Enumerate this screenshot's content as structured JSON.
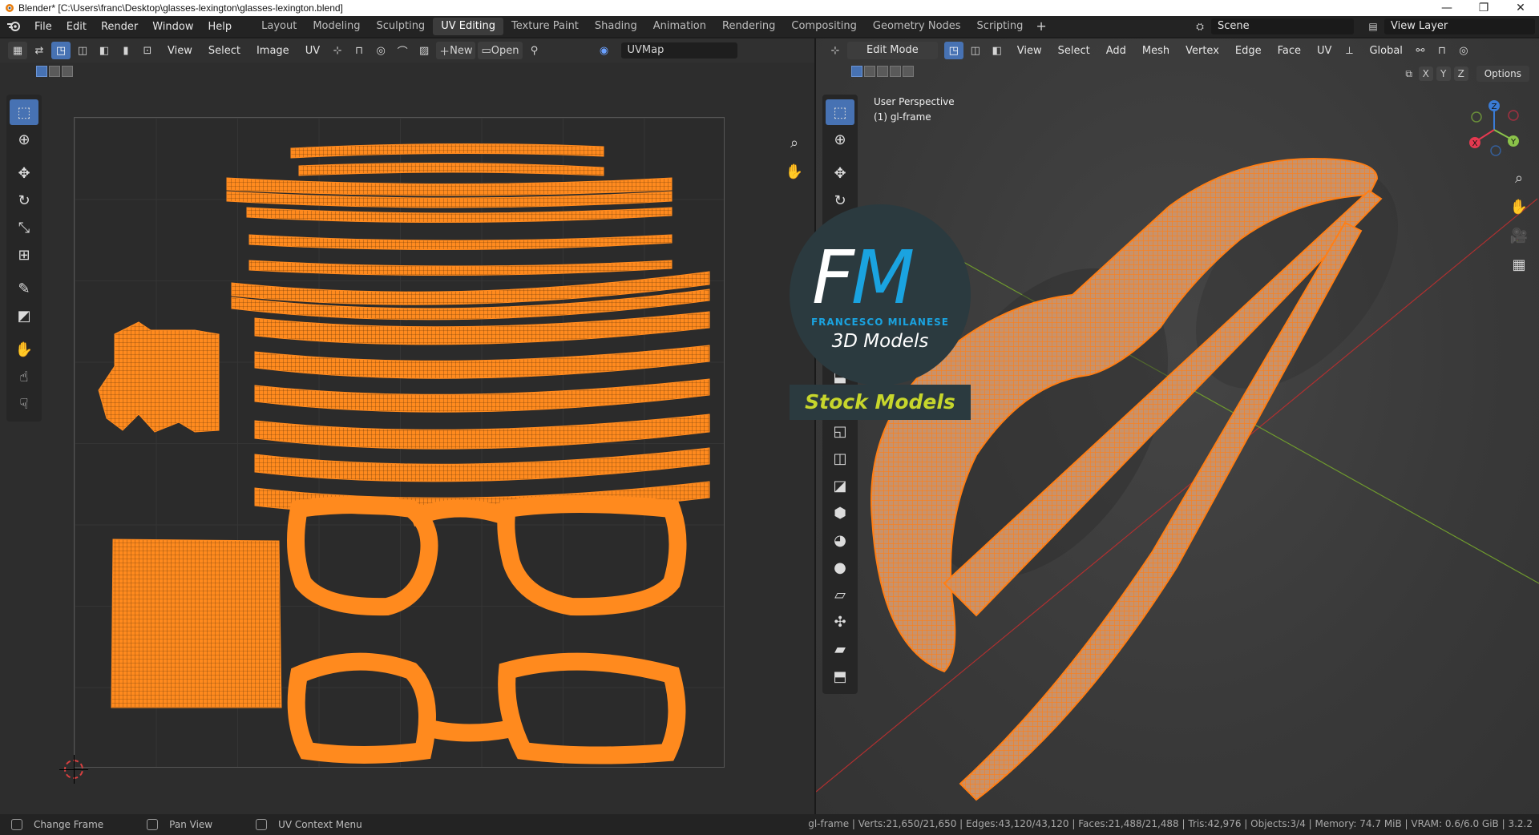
{
  "window": {
    "title": "Blender* [C:\\Users\\franc\\Desktop\\glasses-lexington\\glasses-lexington.blend]",
    "controls": [
      "—",
      "❐",
      "✕"
    ]
  },
  "menus": [
    "File",
    "Edit",
    "Render",
    "Window",
    "Help"
  ],
  "workspaces": {
    "tabs": [
      "Layout",
      "Modeling",
      "Sculpting",
      "UV Editing",
      "Texture Paint",
      "Shading",
      "Animation",
      "Rendering",
      "Compositing",
      "Geometry Nodes",
      "Scripting"
    ],
    "active": "UV Editing",
    "add": "+"
  },
  "scene": {
    "name": "Scene"
  },
  "view_layer": {
    "name": "View Layer"
  },
  "uv_editor": {
    "menus": [
      "View",
      "Select",
      "Image",
      "UV"
    ],
    "new_label": "New",
    "open_label": "Open",
    "uvmap": "UVMap"
  },
  "viewport": {
    "mode": "Edit Mode",
    "menus": [
      "View",
      "Select",
      "Add",
      "Mesh",
      "Vertex",
      "Edge",
      "Face",
      "UV"
    ],
    "orientation": "Global",
    "axes": [
      "X",
      "Y",
      "Z"
    ],
    "options_label": "Options",
    "view_name": "User Perspective",
    "object_name": "(1) gl-frame",
    "gizmo": {
      "x": "X",
      "y": "Y",
      "z": "Z"
    }
  },
  "watermark": {
    "letter_f": "F",
    "letter_m": "M",
    "name": "FRANCESCO MILANESE",
    "tagline": "3D Models",
    "banner": "Stock Models"
  },
  "status": {
    "left_action": "Change Frame",
    "middle_action": "Pan View",
    "right_action": "UV Context Menu",
    "stats": "gl-frame | Verts:21,650/21,650 | Edges:43,120/43,120 | Faces:21,488/21,488 | Tris:42,976 | Objects:3/4 | Memory: 74.7 MiB | VRAM: 0.6/6.0 GiB | 3.2.2"
  },
  "colors": {
    "accent": "#4772b3",
    "uv_orange": "#ff8a1e",
    "brand_blue": "#1aa3e0",
    "brand_green": "#c7d62c"
  }
}
